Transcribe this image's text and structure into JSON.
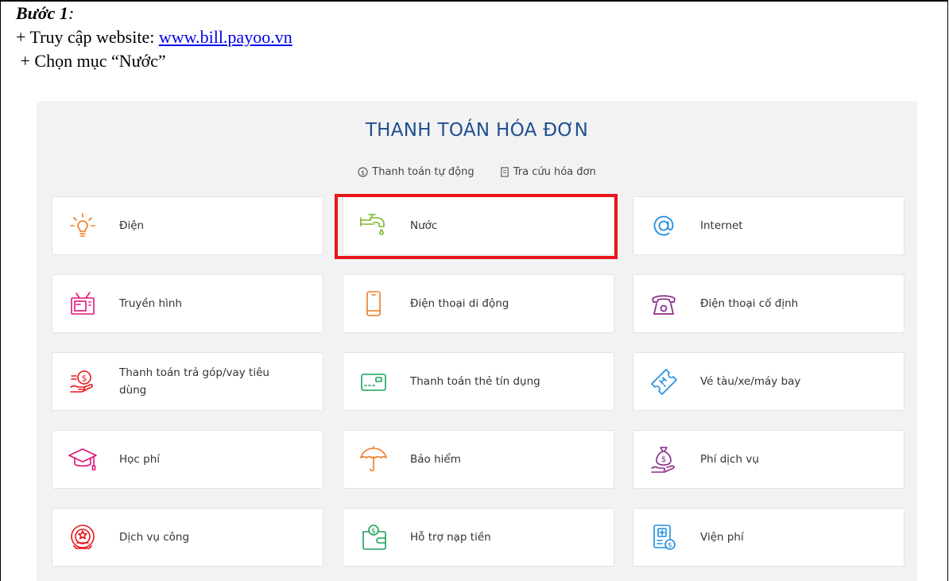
{
  "doc": {
    "step_title": "Bước 1",
    "step_colon": ":",
    "line1_prefix": "+ Truy cập website: ",
    "line1_link": "www.bill.payoo.vn",
    "line2": " + Chọn mục “Nước”"
  },
  "panel": {
    "title": "THANH TOÁN HÓA ĐƠN",
    "quick_links": [
      {
        "label": "Thanh toán tự động",
        "icon": "dollar-circle-icon"
      },
      {
        "label": "Tra cứu hóa đơn",
        "icon": "receipt-icon"
      }
    ],
    "services": [
      {
        "label": "Điện",
        "icon": "lightbulb-icon",
        "color": "#f07a1f"
      },
      {
        "label": "Nước",
        "icon": "water-tap-icon",
        "color": "#7bb828"
      },
      {
        "label": "Internet",
        "icon": "at-sign-icon",
        "color": "#1f8fe0"
      },
      {
        "label": "Truyền hình",
        "icon": "tv-icon",
        "color": "#e0157a"
      },
      {
        "label": "Điện thoại di động",
        "icon": "mobile-phone-icon",
        "color": "#f07a1f"
      },
      {
        "label": "Điện thoại cố định",
        "icon": "landline-phone-icon",
        "color": "#8a2b8a"
      },
      {
        "label": "Thanh toán trả góp/vay tiêu dùng",
        "icon": "installment-loan-icon",
        "color": "#e8151b"
      },
      {
        "label": "Thanh toán thẻ tín dụng",
        "icon": "credit-card-icon",
        "color": "#1aa05a"
      },
      {
        "label": "Vé tàu/xe/máy bay",
        "icon": "ticket-icon",
        "color": "#1f8fe0"
      },
      {
        "label": "Học phí",
        "icon": "graduation-cap-icon",
        "color": "#e0157a"
      },
      {
        "label": "Bảo hiểm",
        "icon": "umbrella-icon",
        "color": "#f07a1f"
      },
      {
        "label": "Phí dịch vụ",
        "icon": "money-bag-icon",
        "color": "#8a2b8a"
      },
      {
        "label": "Dịch vụ công",
        "icon": "public-service-emblem-icon",
        "color": "#e8151b"
      },
      {
        "label": "Hỗ trợ nạp tiền",
        "icon": "wallet-topup-icon",
        "color": "#1aa05a"
      },
      {
        "label": "Viện phí",
        "icon": "hospital-fee-icon",
        "color": "#1f8fe0"
      }
    ]
  }
}
